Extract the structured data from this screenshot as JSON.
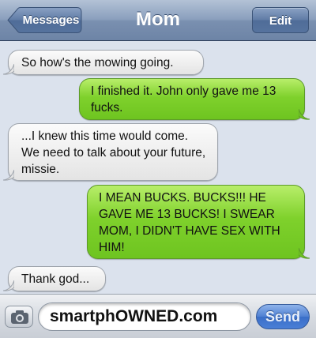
{
  "navbar": {
    "back_label": "Messages",
    "title": "Mom",
    "edit_label": "Edit"
  },
  "messages": [
    {
      "sender": "contact",
      "text": "So how's the mowing going."
    },
    {
      "sender": "me",
      "text": "I finished it. John only gave me 13 fucks."
    },
    {
      "sender": "contact",
      "text": "...I knew this time would come. We need to talk about your future, missie."
    },
    {
      "sender": "me",
      "text": "I MEAN BUCKS. BUCKS!!! HE GAVE ME 13 BUCKS! I SWEAR MOM, I DIDN'T HAVE SEX WITH HIM!"
    },
    {
      "sender": "contact",
      "text": "Thank god..."
    }
  ],
  "composer": {
    "camera_icon": "camera-icon",
    "input_value": "smartphOWNED.com",
    "send_label": "Send"
  },
  "colors": {
    "navbar": "#7a90b0",
    "incoming_bubble": "#e8e8e8",
    "outgoing_bubble": "#7fd12c",
    "background": "#dbe2ed",
    "send_button": "#4a7fd6"
  }
}
